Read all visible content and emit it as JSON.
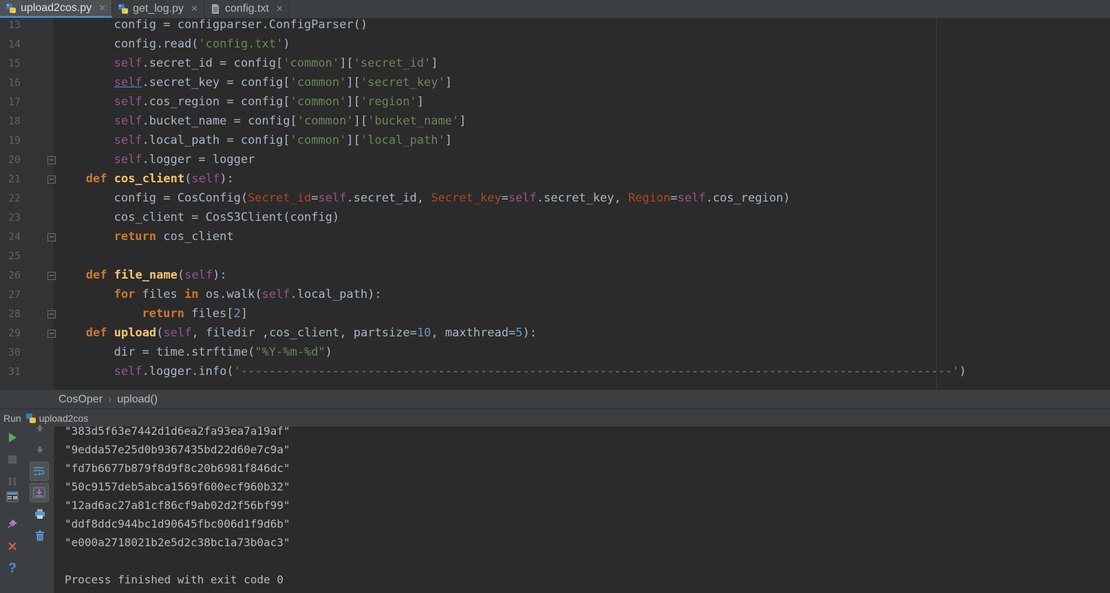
{
  "tabs": [
    {
      "label": "upload2cos.py",
      "active": true,
      "icon": "python-file-icon"
    },
    {
      "label": "get_log.py",
      "active": false,
      "icon": "python-file-icon"
    },
    {
      "label": "config.txt",
      "active": false,
      "icon": "text-file-icon"
    }
  ],
  "editor": {
    "line_numbers": [
      "13",
      "14",
      "15",
      "16",
      "17",
      "18",
      "19",
      "20",
      "21",
      "22",
      "23",
      "24",
      "25",
      "26",
      "27",
      "28",
      "29",
      "30",
      "31"
    ]
  },
  "breadcrumb": {
    "class_name": "CosOper",
    "method_name": "upload()"
  },
  "run": {
    "label": "Run",
    "config_name": "upload2cos",
    "output": [
      "\"383d5f63e7442d1d6ea2fa93ea7a19af\"",
      "\"9edda57e25d0b9367435bd22d60e7c9a\"",
      "\"fd7b6677b879f8d9f8c20b6981f846dc\"",
      "\"50c9157deb5abca1569f600ecf960b32\"",
      "\"12ad6ac27a81cf86cf9ab02d2f56bf99\"",
      "\"ddf8ddc944bc1d90645fbc006d1f9d6b\"",
      "\"e000a2718021b2e5d2c38bc1a73b0ac3\"",
      "",
      "Process finished with exit code 0"
    ]
  },
  "colors": {
    "keyword": "#cc7832",
    "function": "#ffc66d",
    "self": "#94558d",
    "string": "#6a8759",
    "number": "#6897bb",
    "param": "#aa4926"
  }
}
